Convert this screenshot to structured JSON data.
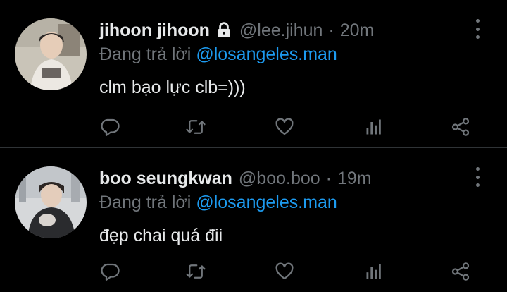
{
  "tweets": [
    {
      "display_name": "jihoon jihoon",
      "handle": "@lee.jihun",
      "separator": "·",
      "time": "20m",
      "replying_label": "Đang trả lời",
      "replying_to": "@losangeles.man",
      "text": "clm bạo lực clb=)))",
      "protected": true
    },
    {
      "display_name": "boo seungkwan",
      "handle": "@boo.boo",
      "separator": "·",
      "time": "19m",
      "replying_label": "Đang trả lời",
      "replying_to": "@losangeles.man",
      "text": "đẹp chai quá đii",
      "protected": false
    }
  ],
  "icons": {
    "reply": "reply-icon",
    "retweet": "retweet-icon",
    "like": "like-icon",
    "views": "views-icon",
    "share": "share-icon",
    "more": "more-icon",
    "lock": "lock-icon"
  },
  "colors": {
    "background": "#000000",
    "text": "#e7e9ea",
    "secondary": "#71767b",
    "accent": "#1d9bf0",
    "divider": "#2f3336"
  }
}
